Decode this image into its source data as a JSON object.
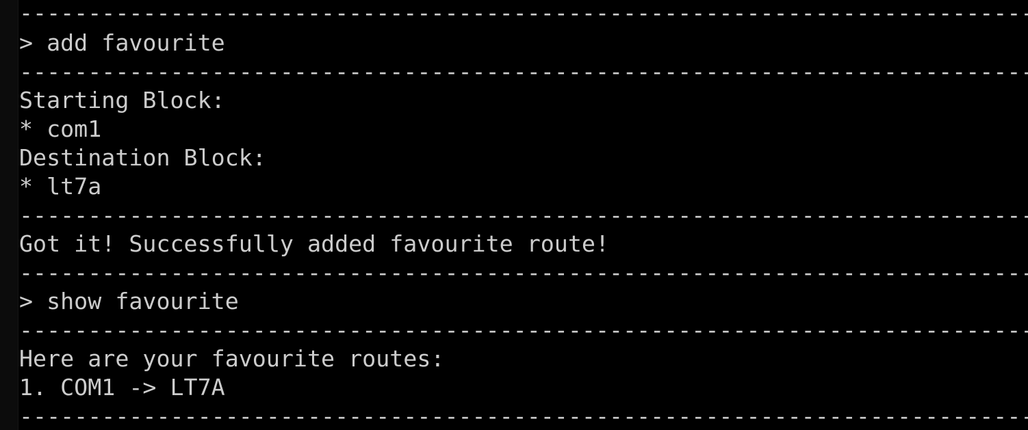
{
  "terminal": {
    "divider": "---------------------------------------------------------------------------",
    "lines": [
      {
        "kind": "divider"
      },
      {
        "kind": "text",
        "name": "command-add-favourite",
        "text": "> add favourite"
      },
      {
        "kind": "divider"
      },
      {
        "kind": "text",
        "name": "starting-block-label",
        "text": "Starting Block:"
      },
      {
        "kind": "text",
        "name": "starting-block-value",
        "text": "* com1"
      },
      {
        "kind": "text",
        "name": "destination-block-label",
        "text": "Destination Block:"
      },
      {
        "kind": "text",
        "name": "destination-block-value",
        "text": "* lt7a"
      },
      {
        "kind": "divider"
      },
      {
        "kind": "text",
        "name": "success-message",
        "text": "Got it! Successfully added favourite route!"
      },
      {
        "kind": "divider"
      },
      {
        "kind": "text",
        "name": "command-show-favourite",
        "text": "> show favourite"
      },
      {
        "kind": "divider"
      },
      {
        "kind": "text",
        "name": "favourite-routes-heading",
        "text": "Here are your favourite routes:"
      },
      {
        "kind": "text",
        "name": "favourite-route-item",
        "text": "1. COM1 -> LT7A"
      },
      {
        "kind": "divider"
      }
    ]
  }
}
